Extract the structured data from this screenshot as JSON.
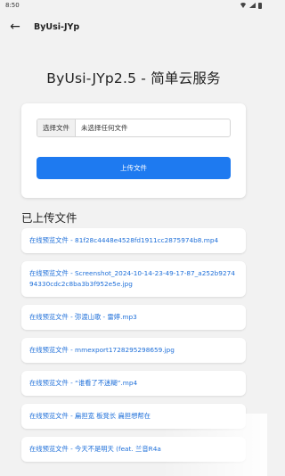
{
  "status": {
    "time": "8:50"
  },
  "appbar": {
    "title": "ByUsi-JYp"
  },
  "page": {
    "title": "ByUsi-JYp2.5 - 简单云服务"
  },
  "upload": {
    "choose_label": "选择文件",
    "no_file_text": "未选择任何文件",
    "upload_label": "上传文件"
  },
  "uploaded": {
    "title": "已上传文件",
    "items": [
      {
        "text": "在线预览文件 - 81f28c4448e4528fd1911cc2875974b8.mp4"
      },
      {
        "text": "在线预览文件 - Screenshot_2024-10-14-23-49-17-87_a252b927494330cdc2c8ba3b3f952e5e.jpg"
      },
      {
        "text": "在线预览文件 - 弥渡山歌 - 雷婷.mp3"
      },
      {
        "text": "在线预览文件 - mmexport1728295298659.jpg"
      },
      {
        "text": "在线预览文件 - “谁看了不迷糊”.mp4"
      },
      {
        "text": "在线预览文件 - 扁担宽 板凳长 扁担想帮在"
      },
      {
        "text": "在线预览文件 - 今天不是明天 (feat. 兰音R4a"
      }
    ]
  }
}
